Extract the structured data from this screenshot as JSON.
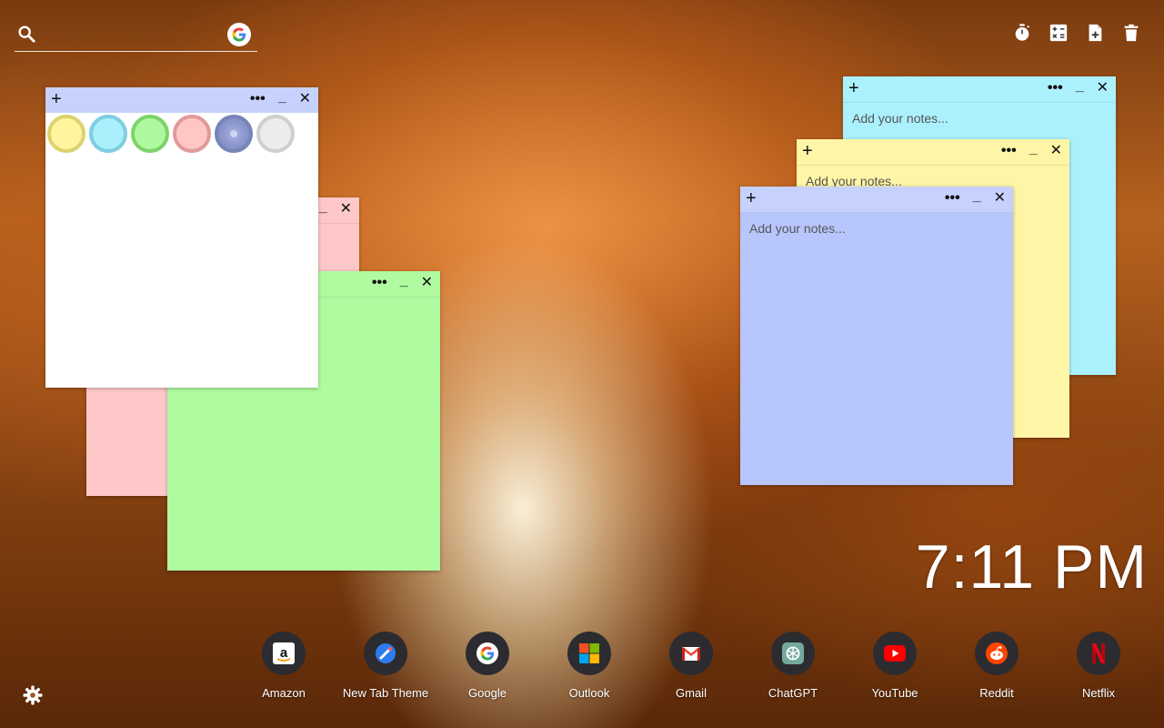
{
  "search": {
    "placeholder": ""
  },
  "toolbar": {
    "icons": [
      "timer-icon",
      "calculator-icon",
      "add-note-icon",
      "trash-icon"
    ]
  },
  "notes": {
    "placeholder": "Add your notes...",
    "plus": "+",
    "dots": "•••",
    "minimize": "_",
    "close": "✕",
    "colors": {
      "white": "#ffffff",
      "pink": "#ffc8c8",
      "green": "#b0fba0",
      "cyan": "#aaf1fd",
      "yellow": "#fef5a6",
      "blue": "#b8c6fe",
      "blue_bar": "#c6d2fd"
    },
    "palette": [
      {
        "name": "yellow",
        "fill": "#fff59f",
        "ring": "#dcd26e"
      },
      {
        "name": "cyan",
        "fill": "#a9effc",
        "ring": "#7fcde0"
      },
      {
        "name": "green",
        "fill": "#aef99f",
        "ring": "#7dd36a"
      },
      {
        "name": "pink",
        "fill": "#ffc6c6",
        "ring": "#e19a9a"
      },
      {
        "name": "blue",
        "fill": "#8a96c8",
        "ring": "#7784b8"
      },
      {
        "name": "gray",
        "fill": "#ececec",
        "ring": "#cfcfcf"
      }
    ]
  },
  "clock": {
    "time": "7:11 PM"
  },
  "dock": {
    "apps": [
      {
        "label": "Amazon",
        "icon": "amazon-icon"
      },
      {
        "label": "New Tab Theme",
        "icon": "new-tab-theme-icon"
      },
      {
        "label": "Google",
        "icon": "google-icon"
      },
      {
        "label": "Outlook",
        "icon": "outlook-icon"
      },
      {
        "label": "Gmail",
        "icon": "gmail-icon"
      },
      {
        "label": "ChatGPT",
        "icon": "chatgpt-icon"
      },
      {
        "label": "YouTube",
        "icon": "youtube-icon"
      },
      {
        "label": "Reddit",
        "icon": "reddit-icon"
      },
      {
        "label": "Netflix",
        "icon": "netflix-icon"
      }
    ]
  },
  "settings": {
    "icon": "gear-icon"
  }
}
